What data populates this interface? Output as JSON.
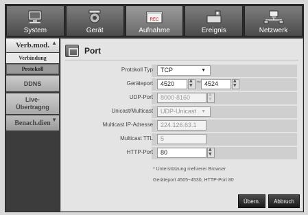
{
  "topnav": [
    {
      "label": "System",
      "icon": "monitor-icon"
    },
    {
      "label": "Gerät",
      "icon": "camera-icon"
    },
    {
      "label": "Aufnahme",
      "icon": "record-icon"
    },
    {
      "label": "Ereignis",
      "icon": "event-icon"
    },
    {
      "label": "Netzwerk",
      "icon": "network-icon"
    }
  ],
  "sidebar": {
    "header": "Verb.mod.",
    "sub_items": [
      "Verbindung",
      "Protokoll"
    ],
    "groups": [
      "DDNS",
      "Live-\nÜbertragng",
      "Benach.dien"
    ]
  },
  "panel": {
    "title": "Port",
    "fields": {
      "protokoll_typ": {
        "label": "Protokoll Typ",
        "value": "TCP"
      },
      "geraeteport": {
        "label": "Geräteport",
        "from": "4520",
        "to": "4524"
      },
      "udp_port": {
        "label": "UDP-Port",
        "value": "8000-8160"
      },
      "unicast_multicast": {
        "label": "Unicast/Multicast",
        "value": "UDP-Unicast"
      },
      "multicast_ip": {
        "label": "Multicast IP-Adresse",
        "value": "224.126.63.1"
      },
      "multicast_ttl": {
        "label": "Multicast TTL",
        "value": "5"
      },
      "http_port": {
        "label": "HTTP-Port",
        "value": "80"
      }
    },
    "notes": [
      "* Unterstützung mehrerer Browser",
      "Geräteport 4505~4530, HTTP-Port 80"
    ],
    "buttons": {
      "apply": "Übern.",
      "cancel": "Abbruch"
    }
  },
  "colors": {
    "top_nav": "#5e5e5e",
    "panel": "#e4e4e4",
    "button": "#2a2a2a"
  }
}
